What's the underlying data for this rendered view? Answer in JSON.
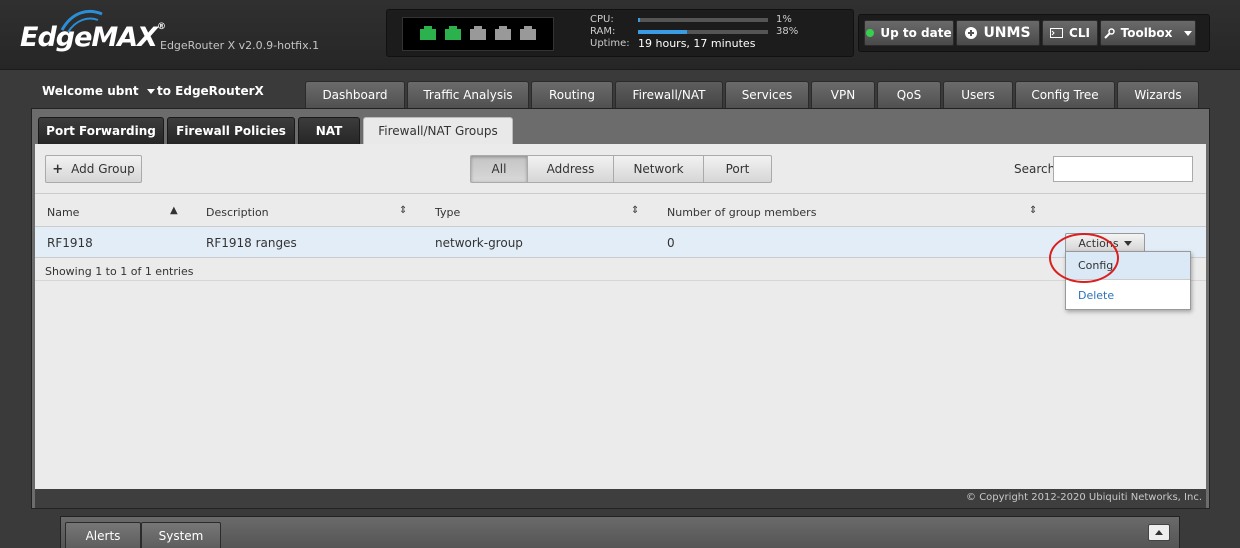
{
  "header": {
    "logo": "EdgeMAX",
    "logo_tm": "®",
    "version": "EdgeRouter X v2.0.9-hotfix.1",
    "ports": [
      true,
      true,
      false,
      false,
      false
    ],
    "cpu_label": "CPU:",
    "cpu_value": "1%",
    "cpu_fraction": 0.01,
    "ram_label": "RAM:",
    "ram_value": "38%",
    "ram_fraction": 0.38,
    "uptime_label": "Uptime:",
    "uptime_value": "19 hours, 17 minutes",
    "buttons": {
      "update": "Up to date",
      "unms": "UNMS",
      "cli": "CLI",
      "toolbox": "Toolbox"
    }
  },
  "welcome": {
    "user": "Welcome ubnt",
    "router": "to EdgeRouterX"
  },
  "main_tabs": [
    "Dashboard",
    "Traffic Analysis",
    "Routing",
    "Firewall/NAT",
    "Services",
    "VPN",
    "QoS",
    "Users",
    "Config Tree",
    "Wizards"
  ],
  "main_tab_active": "Firewall/NAT",
  "sub_tabs": [
    "Port Forwarding",
    "Firewall Policies",
    "NAT",
    "Firewall/NAT Groups"
  ],
  "sub_tab_active": "Firewall/NAT Groups",
  "toolbar": {
    "add_group": "Add Group",
    "filters": [
      "All",
      "Address",
      "Network",
      "Port"
    ],
    "filter_active": "All",
    "search_label": "Search",
    "search_value": ""
  },
  "table": {
    "columns": [
      "Name",
      "Description",
      "Type",
      "Number of group members"
    ],
    "rows": [
      {
        "name": "RF1918",
        "description": "RF1918 ranges",
        "type": "network-group",
        "members": "0"
      }
    ],
    "actions_label": "Actions",
    "info": "Showing 1 to 1 of 1 entries"
  },
  "dropdown": {
    "config": "Config",
    "delete": "Delete"
  },
  "footer": {
    "copyright": "© Copyright 2012-2020 Ubiquiti Networks, Inc."
  },
  "bottom_tabs": [
    "Alerts",
    "System"
  ],
  "colors": {
    "accent_blue": "#3a9de3",
    "port_active": "#2bb24c",
    "status_green": "#37d04e",
    "highlight_red": "#d92020",
    "link_blue": "#2e72b8"
  }
}
